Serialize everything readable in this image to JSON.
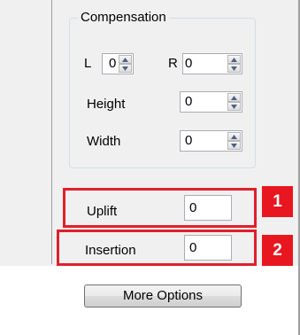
{
  "compensation": {
    "title": "Compensation",
    "left_label": "L",
    "left_value": "0",
    "right_label": "R",
    "right_value": "0",
    "height_label": "Height",
    "height_value": "0",
    "width_label": "Width",
    "width_value": "0"
  },
  "uplift": {
    "label": "Uplift",
    "value": "0",
    "marker": "1"
  },
  "insertion": {
    "label": "Insertion",
    "value": "0",
    "marker": "2"
  },
  "more_options_label": "More Options",
  "colors": {
    "highlight": "#e0202a",
    "marker": "#e8161f"
  }
}
